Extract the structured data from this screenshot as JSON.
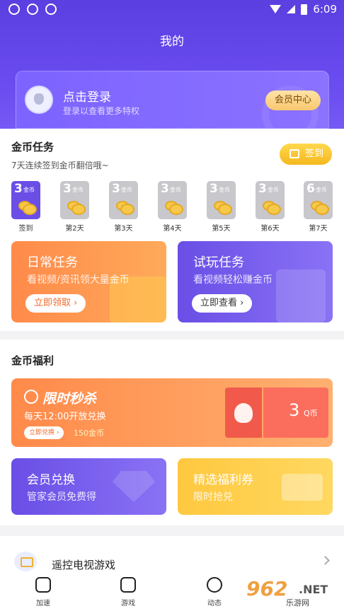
{
  "status": {
    "time": "6:09"
  },
  "header": {
    "title": "我的"
  },
  "login": {
    "title": "点击登录",
    "subtitle": "登录以查看更多特权",
    "vip_button": "会员中心"
  },
  "coin_task": {
    "title": "金币任务",
    "subtitle": "7天连续签到金币翻倍哦~",
    "sign_button": "签到",
    "days": [
      {
        "amount": "3",
        "unit": "金币",
        "label": "签到",
        "active": true
      },
      {
        "amount": "3",
        "unit": "金币",
        "label": "第2天",
        "active": false
      },
      {
        "amount": "3",
        "unit": "金币",
        "label": "第3天",
        "active": false
      },
      {
        "amount": "3",
        "unit": "金币",
        "label": "第4天",
        "active": false
      },
      {
        "amount": "3",
        "unit": "金币",
        "label": "第5天",
        "active": false
      },
      {
        "amount": "3",
        "unit": "金币",
        "label": "第6天",
        "active": false
      },
      {
        "amount": "6",
        "unit": "金币",
        "label": "第7天",
        "active": false
      }
    ],
    "daily": {
      "title": "日常任务",
      "subtitle": "看视频/资讯领大量金币",
      "button": "立即领取 ›"
    },
    "trial": {
      "title": "试玩任务",
      "subtitle": "看视频轻松赚金币",
      "button": "立即查看 ›"
    }
  },
  "welfare": {
    "title": "金币福利",
    "flash": {
      "title": "限时秒杀",
      "subtitle": "每天12:00开放兑换",
      "button": "立即兑换 ›",
      "price": "150金币",
      "coupon_value": "3",
      "coupon_unit": "Q币"
    },
    "vip_exchange": {
      "title": "会员兑换",
      "subtitle": "管家会员免费得"
    },
    "coupons": {
      "title": "精选福利券",
      "subtitle": "限时抢兑"
    }
  },
  "list": {
    "tv_games": "遥控电视游戏"
  },
  "tabs": [
    {
      "label": "加速",
      "icon": "rocket-icon"
    },
    {
      "label": "游戏",
      "icon": "gamepad-icon"
    },
    {
      "label": "动态",
      "icon": "chat-icon"
    }
  ],
  "watermark": {
    "brand": "962",
    "net": ".NET",
    "sub": "乐游网"
  },
  "colors": {
    "primary": "#6a4ee6",
    "orange": "#ff8a4a",
    "gold": "#f5b81e"
  }
}
